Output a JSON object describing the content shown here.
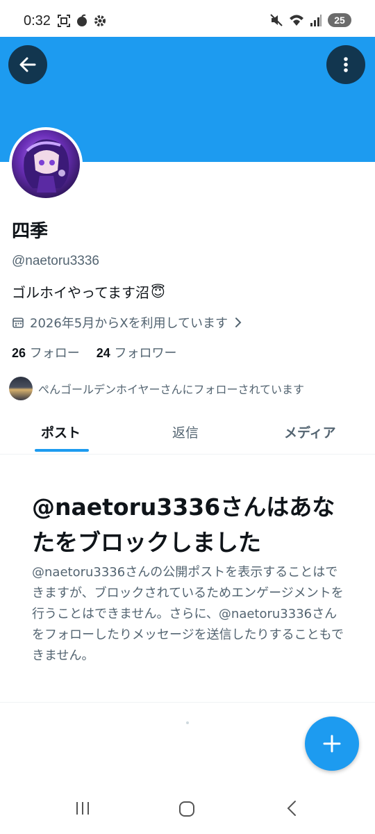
{
  "status_bar": {
    "time": "0:32",
    "battery": "25",
    "icons_left": [
      "screenshot-icon",
      "app-icon",
      "settings-icon"
    ],
    "icons_right": [
      "mute-icon",
      "wifi-icon",
      "signal-icon",
      "battery-icon"
    ]
  },
  "colors": {
    "accent": "#1d9bf0",
    "text_primary": "#0f1419",
    "text_secondary": "#536471"
  },
  "header": {
    "back_icon": "back-arrow-icon",
    "more_icon": "more-vertical-icon"
  },
  "profile": {
    "display_name": "四季",
    "handle": "@naetoru3336",
    "bio": "ゴルホイやってます沼",
    "bio_emoji": "😇",
    "joined": "2026年5月からXを利用しています",
    "following_count": "26",
    "following_label": "フォロー",
    "followers_count": "24",
    "followers_label": "フォロワー",
    "followed_by": "ぺんゴールデンホイヤーさんにフォローされています"
  },
  "tabs": [
    {
      "label": "ポスト",
      "active": true
    },
    {
      "label": "返信",
      "active": false
    },
    {
      "label": "メディア",
      "active": false
    }
  ],
  "blocked": {
    "title": "@naetoru3336さんはあなたをブロックしました",
    "description": "@naetoru3336さんの公開ポストを表示することはできますが、ブロックされているためエンゲージメントを行うことはできません。さらに、@naetoru3336さんをフォローしたりメッセージを送信したりすることもできません。"
  },
  "fab": {
    "icon": "plus-icon"
  },
  "nav_bar": {
    "icons": [
      "recent-apps-icon",
      "home-icon",
      "back-icon"
    ]
  }
}
